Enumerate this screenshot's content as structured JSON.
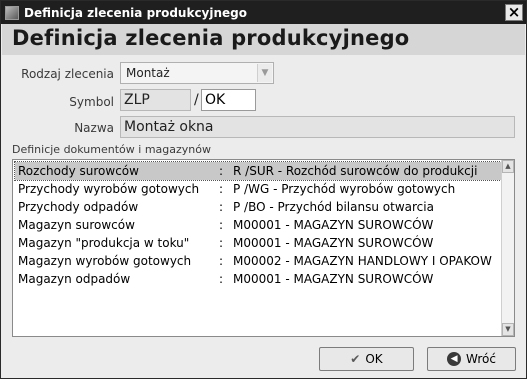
{
  "window": {
    "title": "Definicja zlecenia produkcyjnego",
    "close_glyph": "×"
  },
  "header": {
    "title": "Definicja zlecenia produkcyjnego"
  },
  "form": {
    "rodzaj_label": "Rodzaj zlecenia",
    "rodzaj_value": "Montaż",
    "symbol_label": "Symbol",
    "symbol_prefix": "ZLP",
    "symbol_separator": "/",
    "symbol_value": "OK",
    "nazwa_label": "Nazwa",
    "nazwa_value": "Montaż okna"
  },
  "definitions": {
    "label": "Definicje dokumentów i magazynów",
    "rows": [
      {
        "name": "Rozchody surowców",
        "sep": ":",
        "value": "R /SUR - Rozchód surowców do produkcji",
        "selected": true
      },
      {
        "name": "Przychody wyrobów gotowych",
        "sep": ":",
        "value": "P /WG  - Przychód wyrobów gotowych",
        "selected": false
      },
      {
        "name": "Przychody odpadów",
        "sep": ":",
        "value": "P /BO  - Przychód bilansu otwarcia",
        "selected": false
      },
      {
        "name": "Magazyn surowców",
        "sep": ":",
        "value": "M00001 - MAGAZYN SUROWCÓW",
        "selected": false
      },
      {
        "name": "Magazyn \"produkcja w toku\"",
        "sep": ":",
        "value": "M00001 - MAGAZYN SUROWCÓW",
        "selected": false
      },
      {
        "name": "Magazyn wyrobów gotowych",
        "sep": ":",
        "value": "M00002 - MAGAZYN HANDLOWY I OPAKOW",
        "selected": false
      },
      {
        "name": "Magazyn odpadów",
        "sep": ":",
        "value": "M00001 - MAGAZYN SUROWCÓW",
        "selected": false
      }
    ]
  },
  "buttons": {
    "ok_label": "OK",
    "back_label": "Wróć"
  },
  "icons": {
    "ok": "check-icon",
    "back": "back-arrow-icon",
    "combo": "chevron-down-icon",
    "scroll_up": "scroll-up-icon",
    "scroll_down": "scroll-down-icon"
  }
}
